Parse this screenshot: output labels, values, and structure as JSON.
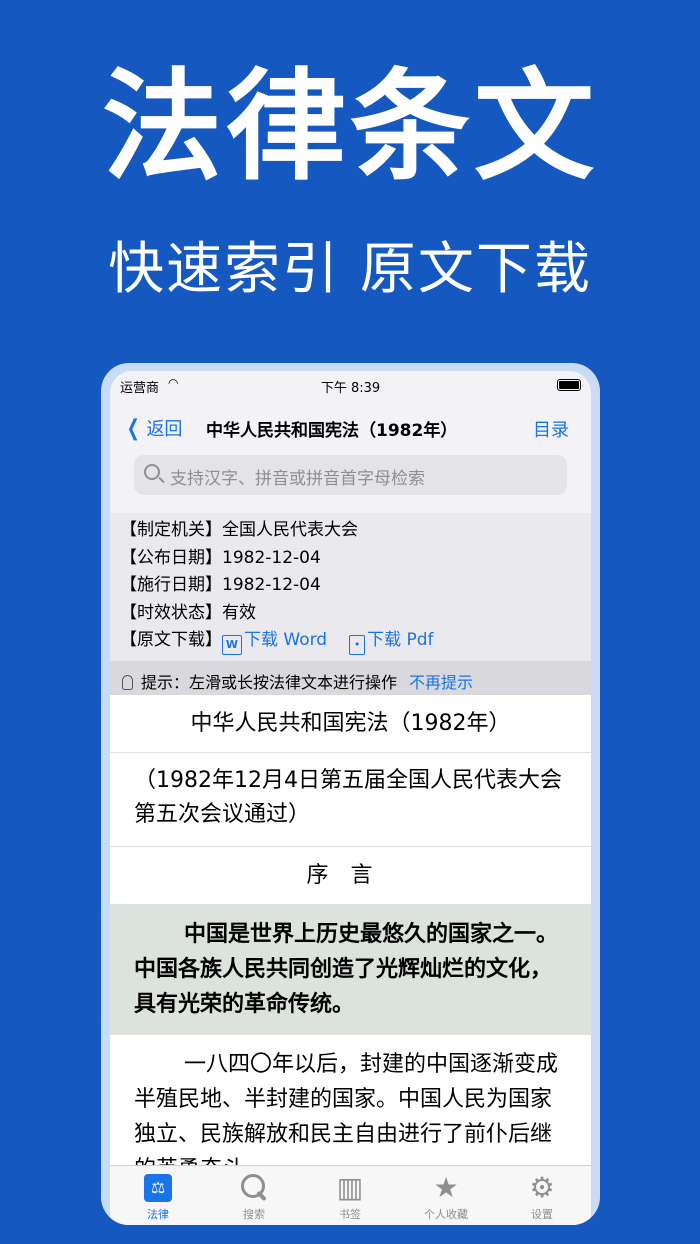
{
  "promo": {
    "headline": "法律条文",
    "subline": "快速索引 原文下载"
  },
  "status_bar": {
    "carrier": "运营商",
    "time": "下午 8:39"
  },
  "nav": {
    "back_label": "返回",
    "title": "中华人民共和国宪法（1982年）",
    "toc_label": "目录"
  },
  "search": {
    "placeholder": "支持汉字、拼音或拼音首字母检索"
  },
  "meta": {
    "authority_label": "【制定机关】",
    "authority": "全国人民代表大会",
    "published_label": "【公布日期】",
    "published": "1982-12-04",
    "effective_label": "【施行日期】",
    "effective": "1982-12-04",
    "status_label": "【时效状态】",
    "status": "有效",
    "download_label": "【原文下载】",
    "download_word": "下载 Word",
    "download_pdf": "下载 Pdf"
  },
  "tip": {
    "text": "提示：左滑或长按法律文本进行操作",
    "dismiss": "不再提示"
  },
  "content": {
    "law_title": "中华人民共和国宪法（1982年）",
    "adoption_note": "（1982年12月4日第五届全国人民代表大会第五次会议通过）",
    "preamble_heading": "序言",
    "para1": "中国是世界上历史最悠久的国家之一。中国各族人民共同创造了光辉灿烂的文化，具有光荣的革命传统。",
    "para2": "一八四〇年以后，封建的中国逐渐变成半殖民地、半封建的国家。中国人民为国家独立、民族解放和民主自由进行了前仆后继的英勇奋斗。"
  },
  "tabs": [
    {
      "label": "法律",
      "icon": "law-icon",
      "active": true
    },
    {
      "label": "搜索",
      "icon": "search-icon",
      "active": false
    },
    {
      "label": "书签",
      "icon": "book-icon",
      "active": false
    },
    {
      "label": "个人收藏",
      "icon": "star-icon",
      "active": false
    },
    {
      "label": "设置",
      "icon": "gear-icon",
      "active": false
    }
  ],
  "colors": {
    "background": "#1558c0",
    "accent": "#1a73e8",
    "highlight": "#dce2dc"
  }
}
